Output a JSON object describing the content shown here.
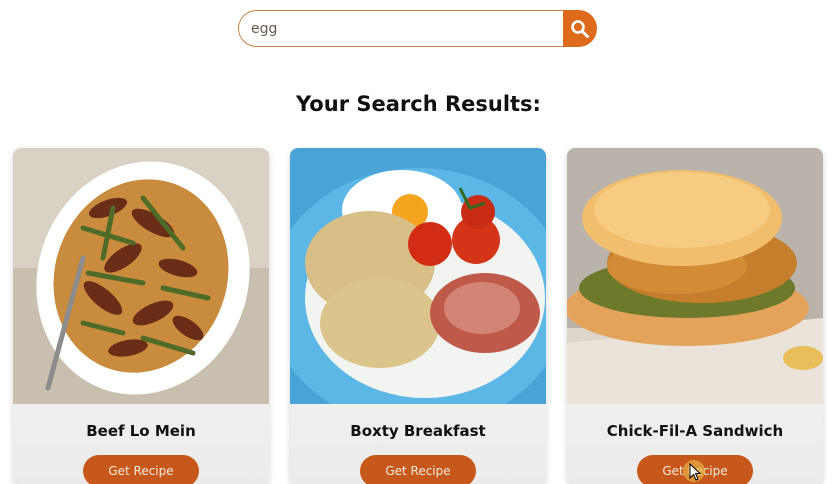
{
  "search": {
    "value": "egg",
    "button_icon": "search-icon"
  },
  "results_title": "Your Search Results:",
  "cards": [
    {
      "title": "Beef Lo Mein",
      "button": "Get Recipe",
      "image": "beef-lo-mein-photo"
    },
    {
      "title": "Boxty Breakfast",
      "button": "Get Recipe",
      "image": "boxty-breakfast-photo"
    },
    {
      "title": "Chick-Fil-A Sandwich",
      "button": "Get Recipe",
      "image": "chicken-sandwich-photo"
    }
  ],
  "colors": {
    "accent": "#dd6b1b",
    "button": "#c5581a",
    "input_border": "#c8874a"
  }
}
